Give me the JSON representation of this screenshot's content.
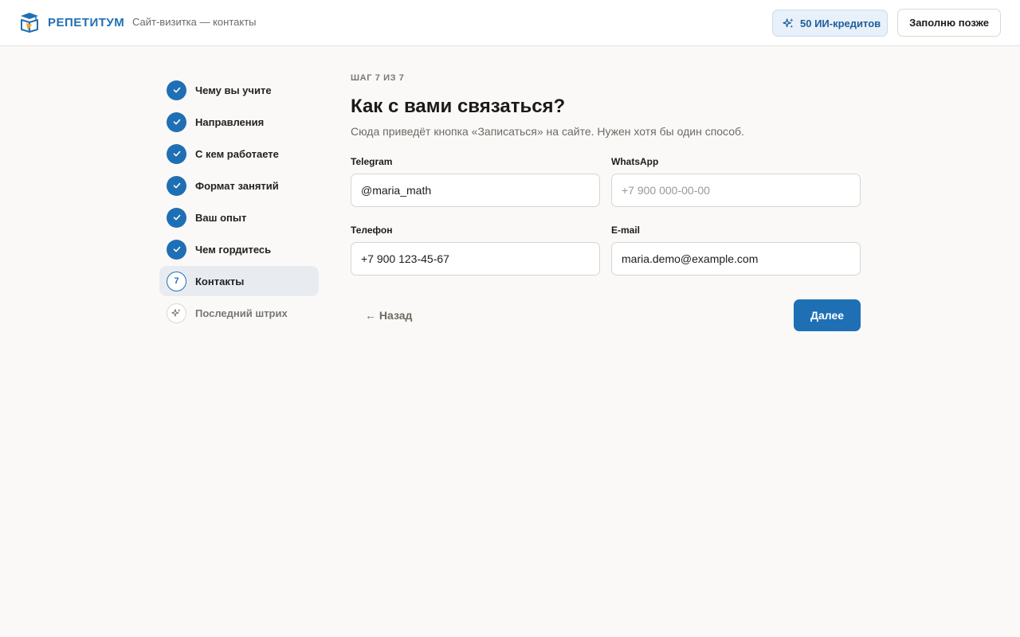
{
  "header": {
    "brand": "РЕПЕТИТУМ",
    "subtitle": "Сайт-визитка — контакты",
    "credits_label": "50 ИИ-кредитов",
    "later_label": "Заполню позже"
  },
  "sidebar": {
    "steps": [
      {
        "label": "Чему вы учите",
        "status": "done"
      },
      {
        "label": "Направления",
        "status": "done"
      },
      {
        "label": "С кем работаете",
        "status": "done"
      },
      {
        "label": "Формат занятий",
        "status": "done"
      },
      {
        "label": "Ваш опыт",
        "status": "done"
      },
      {
        "label": "Чем гордитесь",
        "status": "done"
      },
      {
        "label": "Контакты",
        "status": "current",
        "number": "7"
      },
      {
        "label": "Последний штрих",
        "status": "future"
      }
    ]
  },
  "main": {
    "eyebrow": "ШАГ 7 ИЗ 7",
    "title": "Как с вами связаться?",
    "description": "Сюда приведёт кнопка «Записаться» на сайте. Нужен хотя бы один способ.",
    "fields": {
      "telegram": {
        "label": "Telegram",
        "value": "@maria_math",
        "placeholder": ""
      },
      "whatsapp": {
        "label": "WhatsApp",
        "value": "",
        "placeholder": "+7 900 000-00-00"
      },
      "phone": {
        "label": "Телефон",
        "value": "+7 900 123-45-67",
        "placeholder": ""
      },
      "email": {
        "label": "E-mail",
        "value": "maria.demo@example.com",
        "placeholder": ""
      }
    },
    "back_label": "← Назад",
    "next_label": "Далее"
  },
  "colors": {
    "accent": "#1f6fb5",
    "background": "#faf9f7",
    "credits_bg": "#e8f0f9"
  },
  "icons": {
    "logo": "book-graduation-icon",
    "credits": "sparkle-icon",
    "done": "check-icon",
    "future": "sparkle-icon"
  }
}
